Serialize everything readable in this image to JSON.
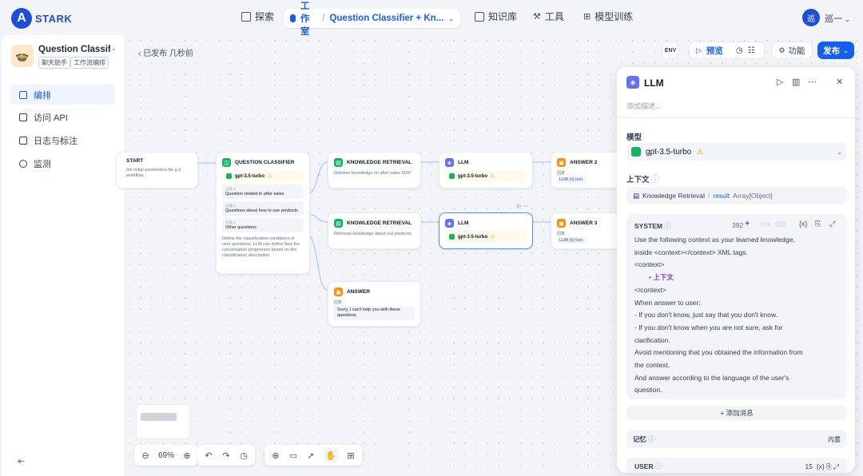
{
  "brand": {
    "logo_letter": "A",
    "name": "STARK",
    "accent": "#155eef"
  },
  "nav": {
    "explore": "探索",
    "studio": "工作室",
    "app_crumb": "Question Classifier + Kn...",
    "knowledge": "知识库",
    "tools": "工具",
    "training": "模型训练"
  },
  "user": {
    "avatar": "巡",
    "name": "巡一"
  },
  "sidebar": {
    "app_name": "Question Classif...",
    "tags": [
      "聊天助手",
      "工作流编排"
    ],
    "items": [
      {
        "label": "编排",
        "icon": "layout-icon",
        "active": true
      },
      {
        "label": "访问 API",
        "icon": "terminal-icon",
        "active": false
      },
      {
        "label": "日志与标注",
        "icon": "file-icon",
        "active": false
      },
      {
        "label": "监测",
        "icon": "gauge-icon",
        "active": false
      }
    ]
  },
  "canvas": {
    "status": "已发布 几秒前",
    "toolbar": {
      "preview": "预览",
      "features": "功能",
      "publish": "发布"
    },
    "zoom": "69%"
  },
  "nodes": {
    "start": {
      "title": "START",
      "desc": "the initial parameters for g a workflow"
    },
    "classifier": {
      "title": "QUESTION CLASSIFIER",
      "model": "gpt-3.5-turbo",
      "classes": [
        {
          "label": "分类 1",
          "text": "Question related to after sales"
        },
        {
          "label": "分类 2",
          "text": "Questions about how to use products"
        },
        {
          "label": "分类 3",
          "text": "Other questions"
        }
      ],
      "desc": "Define the classification conditions of user questions, LLM can define how the conversation progresses based on the classification description."
    },
    "kr1": {
      "title": "KNOWLEDGE RETRIEVAL",
      "desc": "Retrieve knowledge on after sales SOP."
    },
    "kr2": {
      "title": "KNOWLEDGE RETRIEVAL",
      "desc": "Retrieval knowledge about out products."
    },
    "llm1": {
      "title": "LLM",
      "model": "gpt-3.5-turbo"
    },
    "llm2": {
      "title": "LLM",
      "model": "gpt-3.5-turbo"
    },
    "answer2": {
      "title": "ANSWER 2",
      "out_label": "回复",
      "out_value": "LLM",
      "out_type": "{x} text"
    },
    "answer3": {
      "title": "ANSWER 3",
      "out_label": "回复",
      "out_value": "LLM",
      "out_type": "{x} text"
    },
    "answer": {
      "title": "ANSWER",
      "out_label": "回复",
      "text": "Sorry, I can't help you with these questions."
    }
  },
  "panel": {
    "title": "LLM",
    "desc_placeholder": "添加描述...",
    "model_label": "模型",
    "model": "gpt-3.5-turbo",
    "context_label": "上下文",
    "context_var": {
      "node": "Knowledge Retrieval",
      "var": "result",
      "type": "Array[Object]"
    },
    "system": {
      "title": "SYSTEM",
      "count": "392",
      "jinja": "Jinja",
      "lines": [
        "Use the following context as your learned knowledge,",
        "inside <context></context> XML tags.",
        "<context>",
        "</context>",
        "When answer to user:",
        "- If you don't know, just say that you don't know.",
        "- If you don't know when you are not sure, ask for",
        "clarification.",
        "Avoid mentioning that you obtained the information from",
        "the context.",
        "And answer according to the language of the user's",
        "question."
      ],
      "context_chip": "上下文"
    },
    "add_message": "+ 添加消息",
    "memory": {
      "label": "记忆",
      "value": "内置"
    },
    "user_row": {
      "label": "USER",
      "count": "15"
    }
  }
}
